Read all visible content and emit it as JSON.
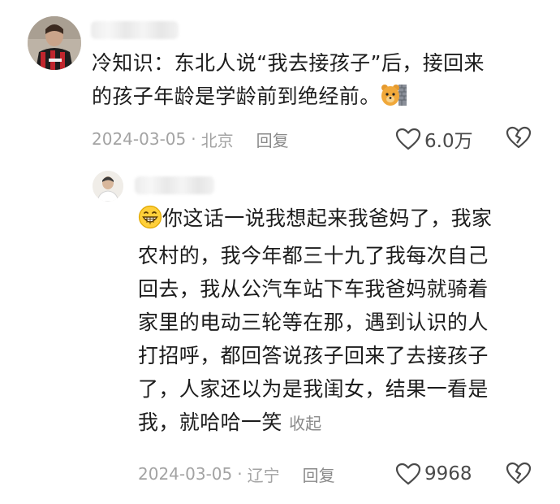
{
  "comment": {
    "author_name": "",
    "text_line1": "冷知识：东北人说“我去接孩子”后，接回来",
    "text_line2": "的孩子年龄是学龄前到绝经前。",
    "date": "2024-03-05",
    "separator": "·",
    "location": "北京",
    "reply_label": "回复",
    "likes": "6.0万",
    "emoji": "bear-emoji"
  },
  "reply": {
    "author_name": "",
    "lines": [
      "你这话一说我想起来我爸妈了，我家",
      "农村的，我今年都三十九了我每次自己",
      "回去，我从公汽车站下车我爸妈就骑着",
      "家里的电动三轮等在那，遇到认识的人",
      "打招呼，都回答说孩子回来了去接孩子",
      "了，人家还以为是我闺女，结果一看是",
      "我，就哈哈一笑"
    ],
    "collapse_label": "收起",
    "date": "2024-03-05",
    "separator": "·",
    "location": "辽宁",
    "reply_label": "回复",
    "likes": "9968",
    "emoji": "grinning-face-emoji"
  }
}
